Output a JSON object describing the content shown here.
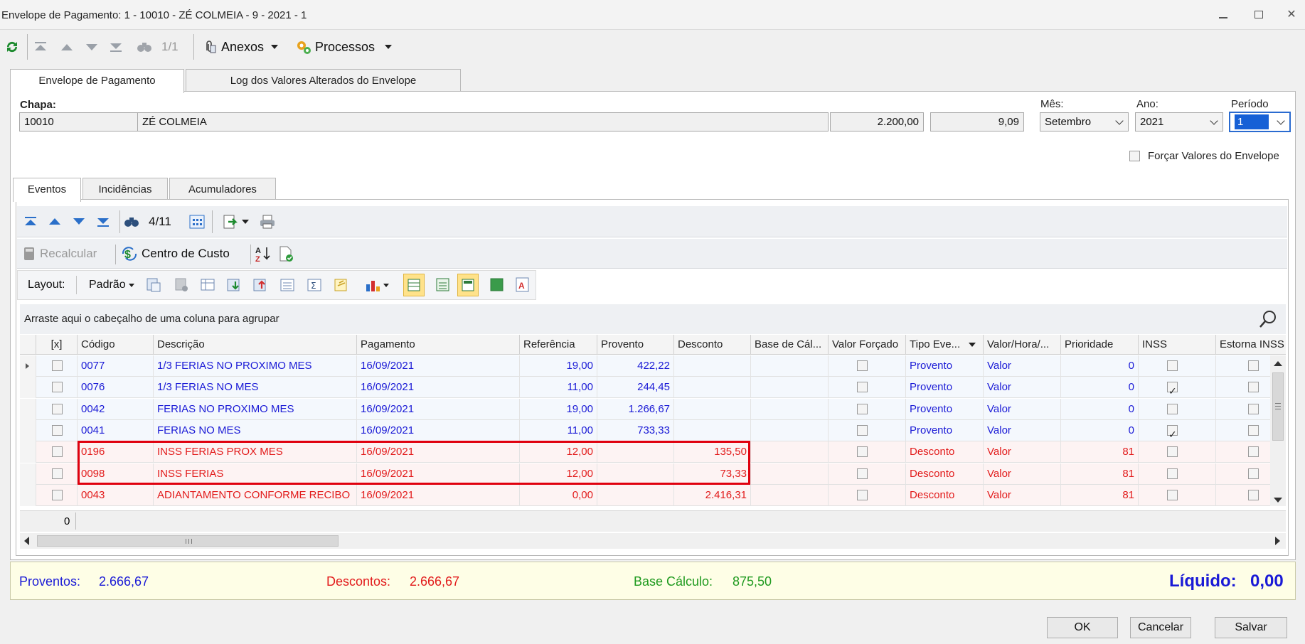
{
  "window": {
    "title": "Envelope de Pagamento: 1 - 10010 - ZÉ COLMEIA - 9 - 2021 - 1",
    "buttons": [
      "minimize",
      "restore",
      "close"
    ]
  },
  "toolbar": {
    "nav_counter": "1/1",
    "anexos_label": "Anexos",
    "processos_label": "Processos"
  },
  "main_tabs": [
    {
      "label": "Envelope de Pagamento",
      "active": true
    },
    {
      "label": "Log dos Valores Alterados do Envelope",
      "active": false
    }
  ],
  "header": {
    "chapa_label": "Chapa:",
    "chapa": "10010",
    "nome": "ZÉ COLMEIA",
    "salario": "2.200,00",
    "valor_hora": "9,09",
    "mes_label": "Mês:",
    "mes": "Setembro",
    "ano_label": "Ano:",
    "ano": "2021",
    "periodo_label": "Período",
    "periodo": "1",
    "forcar_label": "Forçar Valores do Envelope"
  },
  "sub_tabs": [
    {
      "label": "Eventos",
      "active": true
    },
    {
      "label": "Incidências",
      "active": false
    },
    {
      "label": "Acumuladores",
      "active": false
    }
  ],
  "events_toolbar": {
    "counter": "4/11",
    "recalcular_label": "Recalcular",
    "centro_custo_label": "Centro de Custo",
    "layout_label": "Layout:",
    "layout_value": "Padrão"
  },
  "grid": {
    "group_hint": "Arraste aqui o cabeçalho de uma coluna para agrupar",
    "columns": [
      "[x]",
      "Código",
      "Descrição",
      "Pagamento",
      "Referência",
      "Provento",
      "Desconto",
      "Base de Cál...",
      "Valor Forçado",
      "Tipo Eve...",
      "Valor/Hora/...",
      "Prioridade",
      "INSS",
      "Estorna INSS"
    ],
    "rows": [
      {
        "codigo": "0077",
        "descricao": "1/3 FERIAS NO PROXIMO MES",
        "pagamento": "16/09/2021",
        "referencia": "19,00",
        "provento": "422,22",
        "desconto": "",
        "base": "",
        "tipo": "Provento",
        "valor_hora": "Valor",
        "prioridade": "0",
        "inss": false,
        "kind": "prov",
        "current": true
      },
      {
        "codigo": "0076",
        "descricao": "1/3 FERIAS NO MES",
        "pagamento": "16/09/2021",
        "referencia": "11,00",
        "provento": "244,45",
        "desconto": "",
        "base": "",
        "tipo": "Provento",
        "valor_hora": "Valor",
        "prioridade": "0",
        "inss": true,
        "kind": "prov",
        "current": false
      },
      {
        "codigo": "0042",
        "descricao": "FERIAS NO PROXIMO MES",
        "pagamento": "16/09/2021",
        "referencia": "19,00",
        "provento": "1.266,67",
        "desconto": "",
        "base": "",
        "tipo": "Provento",
        "valor_hora": "Valor",
        "prioridade": "0",
        "inss": false,
        "kind": "prov",
        "current": false
      },
      {
        "codigo": "0041",
        "descricao": "FERIAS NO MES",
        "pagamento": "16/09/2021",
        "referencia": "11,00",
        "provento": "733,33",
        "desconto": "",
        "base": "",
        "tipo": "Provento",
        "valor_hora": "Valor",
        "prioridade": "0",
        "inss": true,
        "kind": "prov",
        "current": false
      },
      {
        "codigo": "0196",
        "descricao": "INSS FERIAS PROX MES",
        "pagamento": "16/09/2021",
        "referencia": "12,00",
        "provento": "",
        "desconto": "135,50",
        "base": "",
        "tipo": "Desconto",
        "valor_hora": "Valor",
        "prioridade": "81",
        "inss": false,
        "kind": "desc",
        "current": false
      },
      {
        "codigo": "0098",
        "descricao": "INSS FERIAS",
        "pagamento": "16/09/2021",
        "referencia": "12,00",
        "provento": "",
        "desconto": "73,33",
        "base": "",
        "tipo": "Desconto",
        "valor_hora": "Valor",
        "prioridade": "81",
        "inss": false,
        "kind": "desc",
        "current": false
      },
      {
        "codigo": "0043",
        "descricao": "ADIANTAMENTO CONFORME RECIBO",
        "pagamento": "16/09/2021",
        "referencia": "0,00",
        "provento": "",
        "desconto": "2.416,31",
        "base": "",
        "tipo": "Desconto",
        "valor_hora": "Valor",
        "prioridade": "81",
        "inss": false,
        "kind": "desc",
        "current": false
      }
    ],
    "footer_count": "0"
  },
  "summary": {
    "proventos_label": "Proventos:",
    "proventos": "2.666,67",
    "descontos_label": "Descontos:",
    "descontos": "2.666,67",
    "base_label": "Base Cálculo:",
    "base": "875,50",
    "liquido_label": "Líquido:",
    "liquido": "0,00"
  },
  "buttons": {
    "ok": "OK",
    "cancelar": "Cancelar",
    "salvar": "Salvar"
  },
  "colors": {
    "provento": "#1a1ad6",
    "desconto": "#e21b1b",
    "base": "#1f9a1f",
    "highlight": "#e0000e"
  }
}
